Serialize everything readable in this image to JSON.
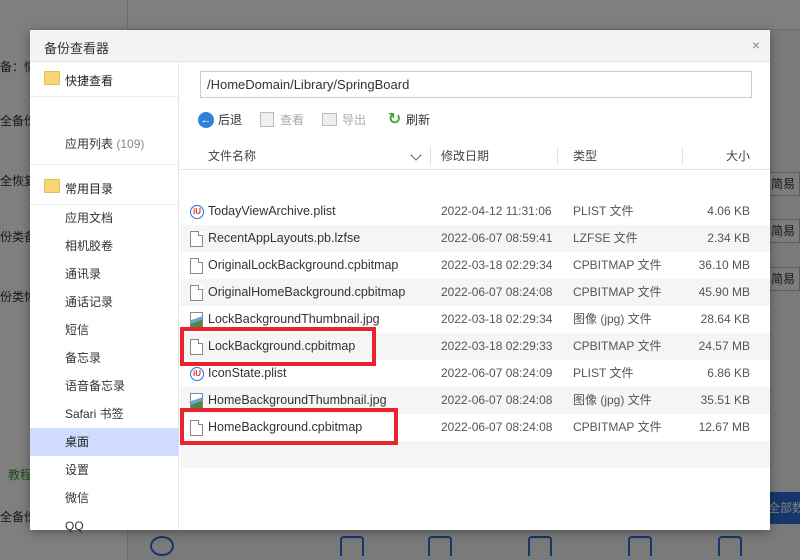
{
  "background": {
    "left_texts": [
      "备：情",
      "全备份",
      "全恢复",
      "份类备",
      "份类恢",
      "教程",
      "全备份"
    ],
    "right_buttons": [
      "简易",
      "简易",
      "简易"
    ],
    "right_blue_button": "全部数"
  },
  "dialog": {
    "title": "备份查看器",
    "close_icon": "×"
  },
  "sidebar": {
    "quick_view_label": "快捷查看",
    "app_list_label": "应用列表",
    "app_list_count": "(109)",
    "common_dirs_label": "常用目录",
    "items": [
      {
        "label": "应用文档"
      },
      {
        "label": "相机胶卷"
      },
      {
        "label": "通讯录"
      },
      {
        "label": "通话记录"
      },
      {
        "label": "短信"
      },
      {
        "label": "备忘录"
      },
      {
        "label": "语音备忘录"
      },
      {
        "label": "Safari 书签"
      },
      {
        "label": "桌面"
      },
      {
        "label": "设置"
      },
      {
        "label": "微信"
      },
      {
        "label": "QQ"
      }
    ],
    "selected_item": "桌面"
  },
  "path_bar": {
    "value": "/HomeDomain/Library/SpringBoard"
  },
  "toolbar": {
    "back": "后退",
    "view": "查看",
    "export": "导出",
    "refresh": "刷新"
  },
  "table": {
    "columns": {
      "name": "文件名称",
      "date": "修改日期",
      "type": "类型",
      "size": "大小"
    },
    "rows": [
      {
        "name": "TodayViewArchive.plist",
        "date": "2022-04-12 11:31:06",
        "type": "PLIST 文件",
        "size": "4.06 KB",
        "icon": "plist-icon"
      },
      {
        "name": "RecentAppLayouts.pb.lzfse",
        "date": "2022-06-07 08:59:41",
        "type": "LZFSE 文件",
        "size": "2.34 KB",
        "icon": "file-icon"
      },
      {
        "name": "OriginalLockBackground.cpbitmap",
        "date": "2022-03-18 02:29:34",
        "type": "CPBITMAP 文件",
        "size": "36.10 MB",
        "icon": "file-icon"
      },
      {
        "name": "OriginalHomeBackground.cpbitmap",
        "date": "2022-06-07 08:24:08",
        "type": "CPBITMAP 文件",
        "size": "45.90 MB",
        "icon": "file-icon"
      },
      {
        "name": "LockBackgroundThumbnail.jpg",
        "date": "2022-03-18 02:29:34",
        "type": "图像 (jpg) 文件",
        "size": "28.64 KB",
        "icon": "image-icon"
      },
      {
        "name": "LockBackground.cpbitmap",
        "date": "2022-03-18 02:29:33",
        "type": "CPBITMAP 文件",
        "size": "24.57 MB",
        "icon": "file-icon"
      },
      {
        "name": "IconState.plist",
        "date": "2022-06-07 08:24:09",
        "type": "PLIST 文件",
        "size": "6.86 KB",
        "icon": "plist-icon"
      },
      {
        "name": "HomeBackgroundThumbnail.jpg",
        "date": "2022-06-07 08:24:08",
        "type": "图像 (jpg) 文件",
        "size": "35.51 KB",
        "icon": "image-icon"
      },
      {
        "name": "HomeBackground.cpbitmap",
        "date": "2022-06-07 08:24:08",
        "type": "CPBITMAP 文件",
        "size": "12.67 MB",
        "icon": "file-icon"
      }
    ],
    "highlighted_rows": [
      "LockBackground.cpbitmap",
      "HomeBackground.cpbitmap"
    ],
    "highlight_color": "#ea2330"
  },
  "colors": {
    "selected_bg": "#d0dcff",
    "accent_blue": "#2e83d8",
    "refresh_green": "#3aa63a"
  }
}
